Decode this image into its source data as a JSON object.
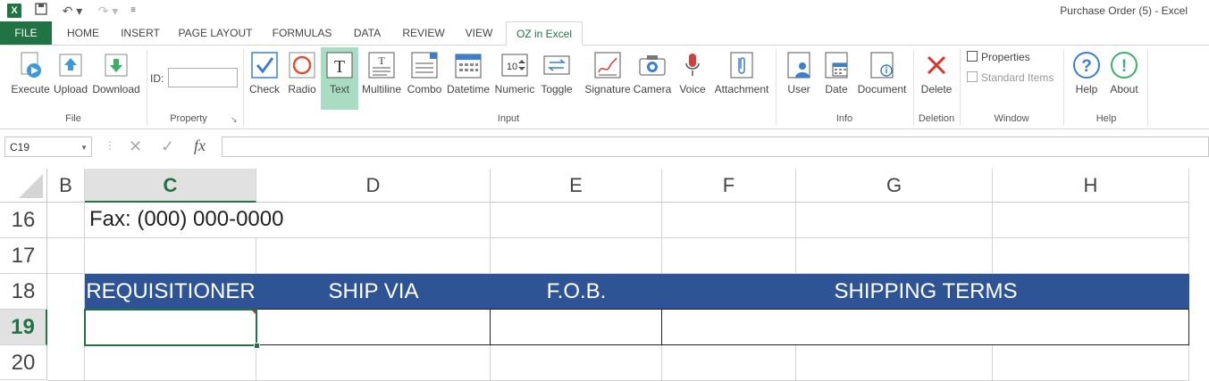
{
  "window": {
    "title": "Purchase Order (5) - Excel"
  },
  "tabs": [
    "FILE",
    "HOME",
    "INSERT",
    "PAGE LAYOUT",
    "FORMULAS",
    "DATA",
    "REVIEW",
    "VIEW",
    "OZ in Excel"
  ],
  "ribbon": {
    "file_group": {
      "label": "File",
      "buttons": [
        "Execute",
        "Upload",
        "Download"
      ]
    },
    "property_group": {
      "label": "Property",
      "id_label": "ID:"
    },
    "input_group": {
      "label": "Input",
      "buttons": [
        "Check",
        "Radio",
        "Text",
        "Multiline",
        "Combo",
        "Datetime",
        "Numeric",
        "Toggle",
        "Signature",
        "Camera",
        "Voice",
        "Attachment"
      ]
    },
    "info_group": {
      "label": "Info",
      "buttons": [
        "User",
        "Date",
        "Document"
      ]
    },
    "deletion_group": {
      "label": "Deletion",
      "buttons": [
        "Delete"
      ]
    },
    "window_group": {
      "label": "Window",
      "properties": "Properties",
      "standard_items": "Standard Items"
    },
    "help_group": {
      "label": "Help",
      "buttons": [
        "Help",
        "About"
      ]
    }
  },
  "formula_bar": {
    "name_box": "C19",
    "fx": "fx"
  },
  "sheet": {
    "columns": [
      "B",
      "C",
      "D",
      "E",
      "F",
      "G",
      "H"
    ],
    "rows": [
      "16",
      "17",
      "18",
      "19",
      "20"
    ],
    "fax": "Fax: (000) 000-0000",
    "headers": [
      "REQUISITIONER",
      "SHIP VIA",
      "F.O.B.",
      "SHIPPING TERMS"
    ]
  },
  "colors": {
    "excel_green": "#217346",
    "header_band": "#2e5496",
    "selected_button": "#a8dcc3"
  }
}
